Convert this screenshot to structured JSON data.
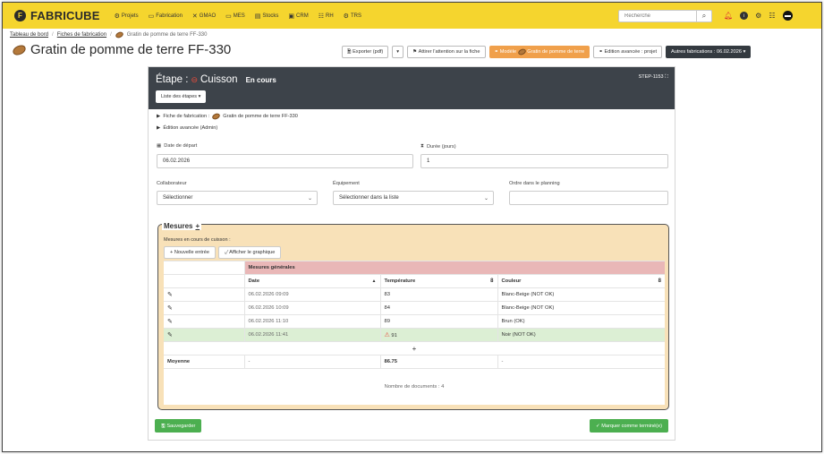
{
  "brand": {
    "name": "FABRICUBE",
    "logo_letter": "F"
  },
  "nav": [
    {
      "icon": "⚙",
      "label": "Projets"
    },
    {
      "icon": "▭",
      "label": "Fabrication"
    },
    {
      "icon": "✕",
      "label": "GMAO"
    },
    {
      "icon": "▭",
      "label": "MES"
    },
    {
      "icon": "▤",
      "label": "Stocks"
    },
    {
      "icon": "▣",
      "label": "CRM"
    },
    {
      "icon": "☷",
      "label": "RH"
    },
    {
      "icon": "⚙",
      "label": "TRS"
    }
  ],
  "search": {
    "placeholder": "Recherche"
  },
  "breadcrumb": {
    "home": "Tableau de bord",
    "list": "Fiches de fabrication",
    "current": "Gratin de pomme de terre FF-330"
  },
  "title": "Gratin de pomme de terre FF-330",
  "actions": {
    "export": "Exporter (pdf)",
    "attention": "Attirer l'attention sur la fiche",
    "model": "Modèle",
    "model_name": "Gratin de pomme de terre",
    "advanced": "Edition avancée : projet",
    "other": "Autres fabrications : 06.02.2026"
  },
  "step": {
    "prefix": "Étape :",
    "name": "Cuisson",
    "status": "En cours",
    "id": "STEP-1153",
    "list_button": "Liste des étapes"
  },
  "details": {
    "fiche": "Fiche de fabrication :",
    "fiche_name": "Gratin de pomme de terre FF-330",
    "advanced": "Édition avancée (Admin)"
  },
  "form": {
    "start_label": "Date de départ",
    "start_value": "06.02.2026",
    "duration_label": "Durée (jours)",
    "duration_value": "1",
    "collab_label": "Collaborateur",
    "collab_value": "Sélectionner",
    "equip_label": "Équipement",
    "equip_value": "Sélectionner dans la liste",
    "order_label": "Ordre dans le planning",
    "order_value": ""
  },
  "mesures": {
    "title": "Mesures",
    "plus": "+",
    "subtitle": "Mesures en cours de cuisson :",
    "new_entry": "Nouvelle entrée",
    "show_chart": "Afficher le graphique",
    "group_header": "Mesures générales",
    "columns": {
      "date": "Date",
      "temp": "Température",
      "color": "Couleur",
      "temp_count": "8",
      "color_count": "8"
    },
    "rows": [
      {
        "date": "06.02.2026 09:09",
        "temp": "83",
        "color": "Blanc-Beige (NOT OK)"
      },
      {
        "date": "06.02.2026 10:09",
        "temp": "84",
        "color": "Blanc-Beige (NOT OK)"
      },
      {
        "date": "06.02.2026 11:10",
        "temp": "89",
        "color": "Brun (OK)"
      },
      {
        "date": "06.02.2026 11:41",
        "temp": "91",
        "color": "Noir (NOT OK)"
      }
    ],
    "add": "+",
    "avg_label": "Moyenne",
    "avg_date": "-",
    "avg_temp": "86.75",
    "avg_color": "-",
    "footer": "Nombre de documents : 4"
  },
  "buttons": {
    "save": "Sauvegarder",
    "done": "Marquer comme terminé(e)"
  },
  "colors": {
    "nav": "#f5d52e",
    "accent_orange": "#f0a04b",
    "success": "#4caf50",
    "header_dark": "#3d434a",
    "panel": "#f8e1b8",
    "group": "#e9b7b7"
  }
}
